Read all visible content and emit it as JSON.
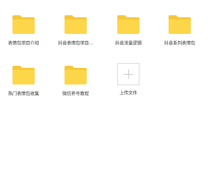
{
  "folders": [
    {
      "label": "表情包项目介绍",
      "icon": "folder-icon"
    },
    {
      "label": "抖音表情包项目...",
      "icon": "folder-icon"
    },
    {
      "label": "抖音流量逻辑",
      "icon": "folder-icon"
    },
    {
      "label": "抖音系列表情包",
      "icon": "folder-icon"
    },
    {
      "label": "热门表情包收集",
      "icon": "folder-icon"
    },
    {
      "label": "微信养号教程",
      "icon": "folder-icon"
    }
  ],
  "upload": {
    "label": "上传文件",
    "icon": "plus-icon"
  },
  "colors": {
    "folder_back": "#F5C73A",
    "folder_front": "#FDD64A",
    "upload_border": "#D9D9D9",
    "text": "#333333"
  }
}
